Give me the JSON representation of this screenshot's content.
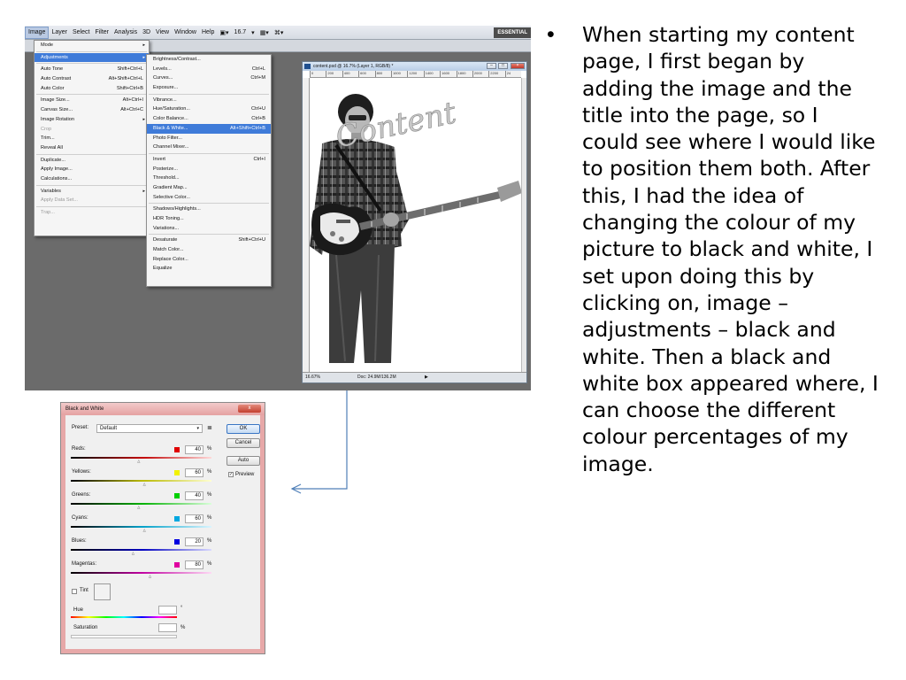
{
  "photoshop": {
    "menubar": [
      "Image",
      "Layer",
      "Select",
      "Filter",
      "Analysis",
      "3D",
      "View",
      "Window",
      "Help"
    ],
    "zoom_tool": "16.7",
    "workspace": "ESSENTIAL",
    "image_menu": {
      "mode": "Mode",
      "adjustments": "Adjustments",
      "auto_tone": "Auto Tone",
      "auto_tone_sc": "Shift+Ctrl+L",
      "auto_contrast": "Auto Contrast",
      "auto_contrast_sc": "Alt+Shift+Ctrl+L",
      "auto_color": "Auto Color",
      "auto_color_sc": "Shift+Ctrl+B",
      "image_size": "Image Size...",
      "image_size_sc": "Alt+Ctrl+I",
      "canvas_size": "Canvas Size...",
      "canvas_size_sc": "Alt+Ctrl+C",
      "image_rotation": "Image Rotation",
      "crop": "Crop",
      "trim": "Trim...",
      "reveal_all": "Reveal All",
      "duplicate": "Duplicate...",
      "apply_image": "Apply Image...",
      "calculations": "Calculations...",
      "variables": "Variables",
      "apply_data_set": "Apply Data Set...",
      "trap": "Trap..."
    },
    "adjustments_menu": {
      "brightness": "Brightness/Contrast...",
      "levels": "Levels...",
      "levels_sc": "Ctrl+L",
      "curves": "Curves...",
      "curves_sc": "Ctrl+M",
      "exposure": "Exposure...",
      "vibrance": "Vibrance...",
      "hue_sat": "Hue/Saturation...",
      "hue_sat_sc": "Ctrl+U",
      "color_balance": "Color Balance...",
      "color_balance_sc": "Ctrl+B",
      "black_white": "Black & White...",
      "black_white_sc": "Alt+Shift+Ctrl+B",
      "photo_filter": "Photo Filter...",
      "channel_mixer": "Channel Mixer...",
      "invert": "Invert",
      "invert_sc": "Ctrl+I",
      "posterize": "Posterize...",
      "threshold": "Threshold...",
      "gradient_map": "Gradient Map...",
      "selective_color": "Selective Color...",
      "shadows": "Shadows/Highlights...",
      "hdr": "HDR Toning...",
      "variations": "Variations...",
      "desaturate": "Desaturate",
      "desaturate_sc": "Shift+Ctrl+U",
      "match_color": "Match Color...",
      "replace_color": "Replace Color...",
      "equalize": "Equalize"
    },
    "document": {
      "title": "content.psd @ 16.7% (Layer 1, RGB/8) *",
      "ruler": [
        "0",
        "200",
        "400",
        "600",
        "800",
        "1000",
        "1200",
        "1400",
        "1600",
        "1800",
        "2000",
        "2200",
        "24"
      ],
      "overlay_text": "Content",
      "zoom": "16.67%",
      "doc_size": "Doc: 24.9M/136.2M"
    }
  },
  "bw_dialog": {
    "title": "Black and White",
    "close": "x",
    "preset_label": "Preset:",
    "preset_value": "Default",
    "preset_menu_icon": "≣",
    "ok": "OK",
    "cancel": "Cancel",
    "auto": "Auto",
    "preview": "Preview",
    "preview_checked": true,
    "percent": "%",
    "sliders": [
      {
        "label": "Reds:",
        "value": "40",
        "color": "#e00000",
        "gradient": [
          "#000000",
          "#c00000",
          "#ffd9d9"
        ]
      },
      {
        "label": "Yellows:",
        "value": "60",
        "color": "#f2f200",
        "gradient": [
          "#000000",
          "#b8b800",
          "#ffffd0"
        ]
      },
      {
        "label": "Greens:",
        "value": "40",
        "color": "#00d000",
        "gradient": [
          "#000000",
          "#00b000",
          "#d9ffd9"
        ]
      },
      {
        "label": "Cyans:",
        "value": "60",
        "color": "#00a8e0",
        "gradient": [
          "#000000",
          "#00a0c8",
          "#d9f5ff"
        ]
      },
      {
        "label": "Blues:",
        "value": "20",
        "color": "#0000e0",
        "gradient": [
          "#000000",
          "#0000c0",
          "#d9d9ff"
        ]
      },
      {
        "label": "Magentas:",
        "value": "80",
        "color": "#e000a0",
        "gradient": [
          "#000000",
          "#c000a0",
          "#ffd9f5"
        ]
      }
    ],
    "tint_label": "Tint",
    "hue_label": "Hue",
    "hue_unit": "°",
    "saturation_label": "Saturation",
    "saturation_unit": "%"
  },
  "bullet": {
    "symbol": "•",
    "text": "When starting my content page, I first began by adding the image and the title into the page, so I could see where I would like to position them both. After this, I had the idea of changing the colour of my picture to black and white, I set upon doing this by clicking on, image – adjustments – black and white. Then a black and white box appeared where, I can choose the different colour percentages of my image."
  }
}
